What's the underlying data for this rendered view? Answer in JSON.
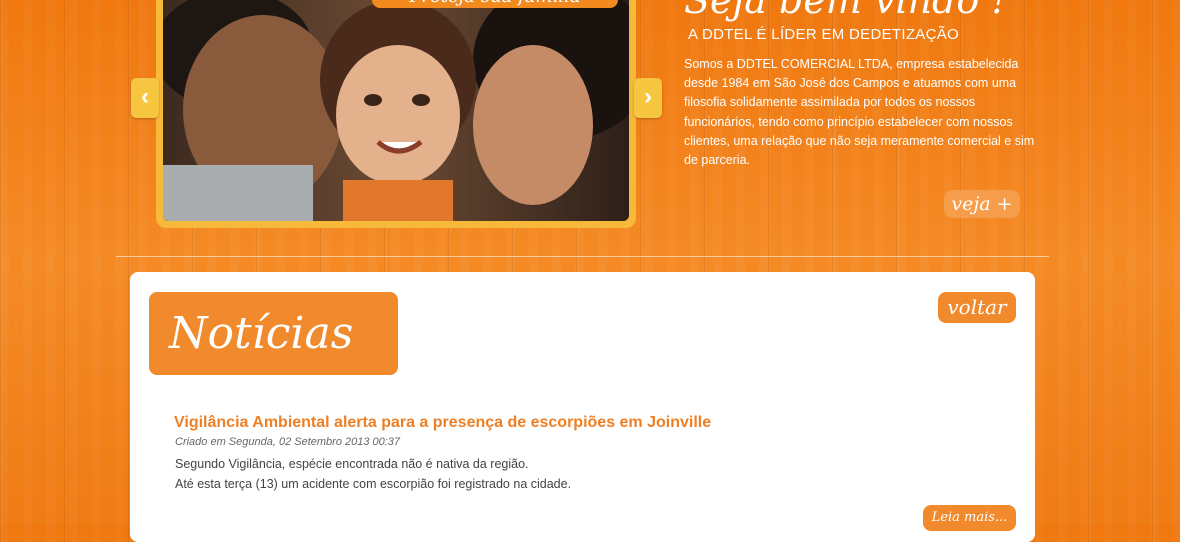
{
  "slider": {
    "caption": "Proteja sua família",
    "prev_glyph": "‹",
    "next_glyph": "›"
  },
  "welcome": {
    "title": "Seja bem vindo !",
    "subtitle": "A DDTEL É LÍDER EM DEDETIZAÇÃO",
    "text": "Somos a DDTEL COMERCIAL LTDA, empresa estabelecida desde 1984 em São José dos Campos e atuamos com uma filosofia solidamente assimilada por todos os nossos funcionários, tendo como princípio estabelecer com nossos clientes, uma relação que não seja meramente comercial e sim de parceria.",
    "more_label": "veja +"
  },
  "news": {
    "heading": "Notícias",
    "back_label": "voltar",
    "article": {
      "title": "Vigilância Ambiental alerta para a presença de escorpiões em Joinville",
      "date": "Criado em Segunda, 02 Setembro 2013 00:37",
      "line1": "Segundo Vigilância, espécie encontrada não é nativa da região.",
      "line2": "Até esta terça (13) um acidente com escorpião foi registrado na cidade.",
      "read_more": "Leia mais..."
    }
  }
}
